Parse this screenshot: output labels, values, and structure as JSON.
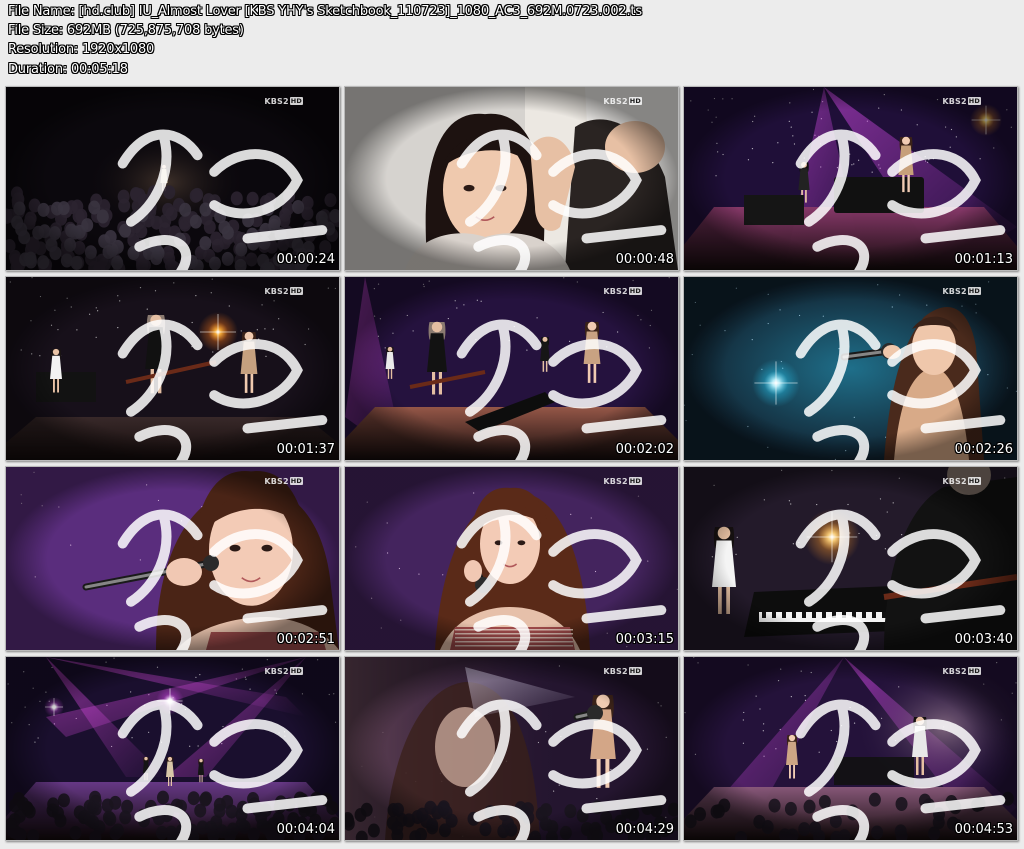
{
  "file_info": {
    "file_name": "File Name: [hd.club] IU_Almost Lover [KBS YHY's Sketchbook_110723]_1080_AC3_692M.0723.002.ts",
    "file_size": "File Size: 692MB (725,875,708 bytes)",
    "resolution": "Resolution: 1920x1080",
    "duration": "Duration: 00:05:18"
  },
  "watermark": {
    "channel": "KBS2",
    "hd": "HD"
  },
  "thumbnails": [
    {
      "time": "00:00:24",
      "scene": "wide-stage-dark-audience",
      "palette": {
        "bg": "#14101a",
        "accent": "#c9b48c"
      }
    },
    {
      "time": "00:00:48",
      "scene": "audience-closeup-smiling-girl",
      "palette": {
        "bg": "#3a2a28",
        "accent": "#e6c2a6"
      }
    },
    {
      "time": "00:01:13",
      "scene": "stage-piano-singer-purple",
      "palette": {
        "bg": "#2b1547",
        "accent": "#c832d8"
      }
    },
    {
      "time": "00:01:37",
      "scene": "band-guitarist-singer-dark",
      "palette": {
        "bg": "#1c1420",
        "accent": "#ff9b2a"
      }
    },
    {
      "time": "00:02:02",
      "scene": "full-band-stage-purple",
      "palette": {
        "bg": "#2a1742",
        "accent": "#d23fe0"
      }
    },
    {
      "time": "00:02:26",
      "scene": "singer-profile-teal-light",
      "palette": {
        "bg": "#16384a",
        "accent": "#36d7ff"
      }
    },
    {
      "time": "00:02:51",
      "scene": "singer-closeup-microphone-purple",
      "palette": {
        "bg": "#5a2d7d",
        "accent": "#f1c8ba"
      }
    },
    {
      "time": "00:03:15",
      "scene": "singer-front-microphone-purple",
      "palette": {
        "bg": "#4a2766",
        "accent": "#f0c6b4"
      }
    },
    {
      "time": "00:03:40",
      "scene": "pianist-guitarist-orange-light",
      "palette": {
        "bg": "#2a1d30",
        "accent": "#ffb84d"
      }
    },
    {
      "time": "00:04:04",
      "scene": "wide-stage-purple-lights-audience",
      "palette": {
        "bg": "#23143a",
        "accent": "#e04ce8"
      }
    },
    {
      "time": "00:04:29",
      "scene": "overlay-closeup-and-full-singer",
      "palette": {
        "bg": "#2b1a38",
        "accent": "#d9b6a6"
      }
    },
    {
      "time": "00:04:53",
      "scene": "overlay-closeup-band-stage",
      "palette": {
        "bg": "#2b1645",
        "accent": "#c44ae0"
      }
    }
  ]
}
